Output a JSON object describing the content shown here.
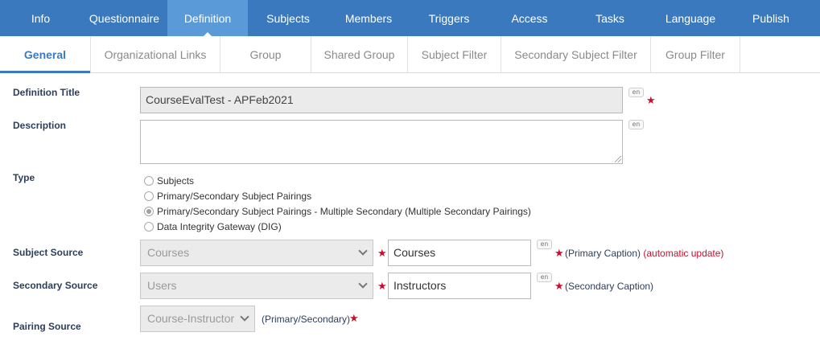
{
  "top_nav": {
    "tabs": [
      "Info",
      "Questionnaire",
      "Definition",
      "Subjects",
      "Members",
      "Triggers",
      "Access",
      "Tasks",
      "Language",
      "Publish"
    ],
    "active": "Definition",
    "colors": {
      "bar": "#3b79be",
      "active": "#5b9ad9"
    }
  },
  "sub_nav": {
    "tabs": [
      "General",
      "Organizational Links",
      "Group",
      "Shared Group",
      "Subject Filter",
      "Secondary Subject Filter",
      "Group Filter"
    ],
    "active": "General"
  },
  "form": {
    "definition_title": {
      "label": "Definition Title",
      "value": "CourseEvalTest - APFeb2021",
      "lang": "en"
    },
    "description": {
      "label": "Description",
      "value": "",
      "lang": "en"
    },
    "type": {
      "label": "Type",
      "options": [
        "Subjects",
        "Primary/Secondary Subject Pairings",
        "Primary/Secondary Subject Pairings - Multiple Secondary (Multiple Secondary Pairings)",
        "Data Integrity Gateway (DIG)"
      ],
      "selected": "Primary/Secondary Subject Pairings - Multiple Secondary (Multiple Secondary Pairings)"
    },
    "subject_source": {
      "label": "Subject Source",
      "selected": "Courses",
      "caption_value": "Courses",
      "lang": "en",
      "caption_note": "(Primary Caption)",
      "auto_note": "(automatic update)"
    },
    "secondary_source": {
      "label": "Secondary Source",
      "selected": "Users",
      "caption_value": "Instructors",
      "lang": "en",
      "caption_note": "(Secondary Caption)"
    },
    "pairing_source": {
      "label": "Pairing Source",
      "selected": "Course-Instructor",
      "note": "(Primary/Secondary)"
    }
  },
  "required_marker": "★",
  "colors": {
    "required": "#c8102e",
    "label": "#2c3e5a"
  }
}
